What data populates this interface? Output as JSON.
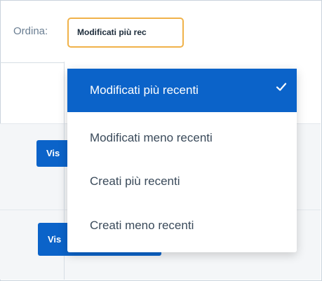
{
  "sort": {
    "label": "Ordina:",
    "selected_value": "Modificati più rec"
  },
  "dropdown": {
    "options": [
      {
        "label": "Modificati più recenti",
        "selected": true
      },
      {
        "label": "Modificati meno recenti",
        "selected": false
      },
      {
        "label": "Creati più recenti",
        "selected": false
      },
      {
        "label": "Creati meno recenti",
        "selected": false
      }
    ]
  },
  "buttons": {
    "view_1": "Vis",
    "view_2": "Vis"
  },
  "colors": {
    "accent": "#0b63c9",
    "select_border": "#f0b24a"
  },
  "icons": {
    "selected_check": "check-icon"
  }
}
